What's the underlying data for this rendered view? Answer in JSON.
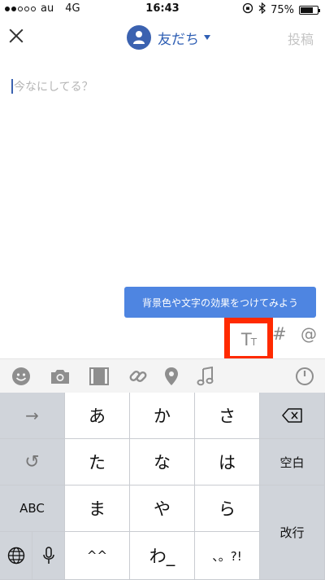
{
  "status_bar": {
    "carrier": "au",
    "network": "4G",
    "time": "16:43",
    "battery_text": "75%",
    "battery_level": 0.75,
    "signal_bars_filled": 2,
    "signal_bars_total": 5
  },
  "header": {
    "audience_label": "友だち",
    "post_label": "投稿"
  },
  "compose": {
    "placeholder": "今なにしてる？"
  },
  "tooltip": {
    "text": "背景色や文字の効果をつけてみよう"
  },
  "text_tools": {
    "text_style_icon": "text-size-icon",
    "hashtag_label": "#",
    "mention_label": "@"
  },
  "attachment_icons": [
    "emoji-icon",
    "camera-icon",
    "video-icon",
    "link-icon",
    "location-icon",
    "music-icon",
    "timer-icon"
  ],
  "keyboard": {
    "arrow": "→",
    "undo": "↺",
    "abc": "ABC",
    "row1": [
      "あ",
      "か",
      "さ"
    ],
    "row2": [
      "た",
      "な",
      "は"
    ],
    "row3": [
      "ま",
      "や",
      "ら"
    ],
    "row4": [
      "^^",
      "わ_",
      "、。?!"
    ],
    "space": "空白",
    "return": "改行"
  },
  "colors": {
    "accent": "#3b62b0",
    "tooltip_bg": "#4e85e1",
    "highlight": "#ff2a00"
  }
}
